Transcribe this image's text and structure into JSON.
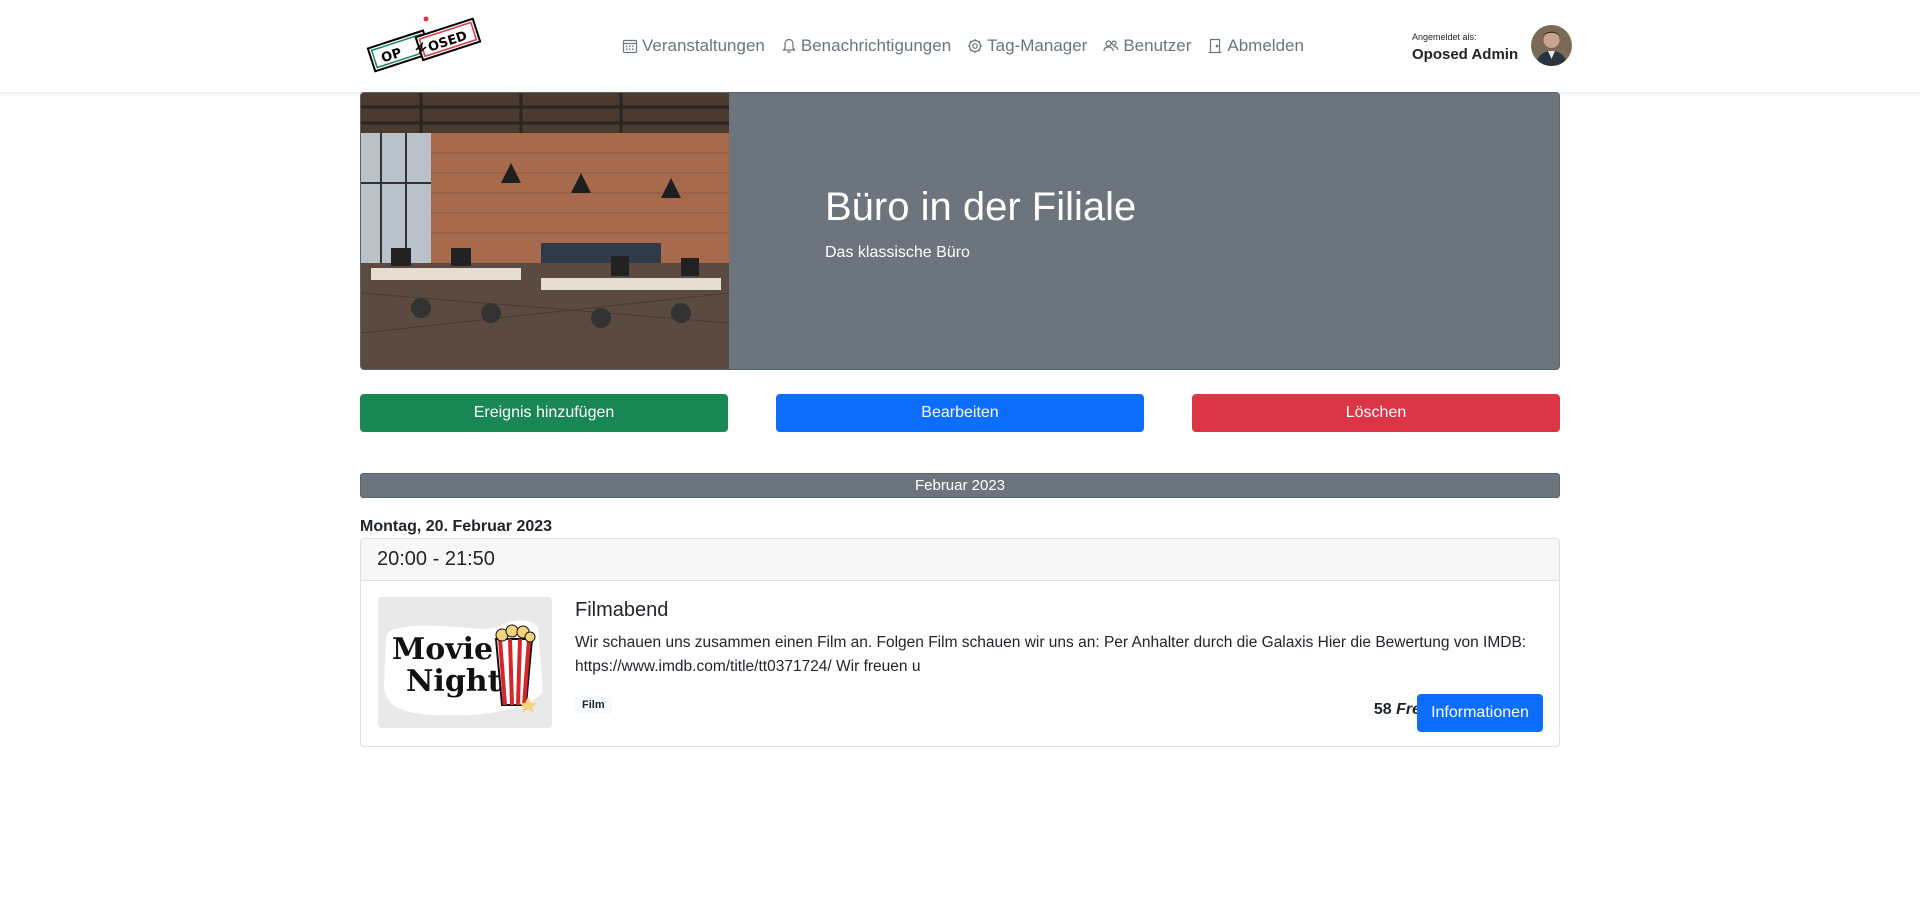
{
  "header": {
    "nav": [
      {
        "label": "Veranstaltungen",
        "icon": "calendar-icon"
      },
      {
        "label": "Benachrichtigungen",
        "icon": "bell-icon"
      },
      {
        "label": "Tag-Manager",
        "icon": "gear-icon"
      },
      {
        "label": "Benutzer",
        "icon": "users-icon"
      },
      {
        "label": "Abmelden",
        "icon": "door-icon"
      }
    ],
    "user_caption": "Angemeldet als:",
    "user_name": "Oposed Admin"
  },
  "hero": {
    "title": "Büro in der Filiale",
    "subtitle": "Das klassische Büro"
  },
  "actions": {
    "add": "Ereignis hinzufügen",
    "edit": "Bearbeiten",
    "delete": "Löschen"
  },
  "month": "Februar 2023",
  "day": "Montag, 20. Februar 2023",
  "event": {
    "time": "20:00 - 21:50",
    "title": "Filmabend",
    "description": "Wir schauen uns zusammen einen Film an. Folgen Film schauen wir uns an: Per Anhalter durch die Galaxis Hier die Bewertung von IMDB: https://www.imdb.com/title/tt0371724/ Wir freuen u",
    "tag": "Film",
    "seats_count": "58",
    "seats_label": "Freie Plätze",
    "info_button": "Informationen"
  },
  "colors": {
    "success": "#198754",
    "primary": "#0d6efd",
    "danger": "#dc3545",
    "secondary": "#6c757d"
  }
}
